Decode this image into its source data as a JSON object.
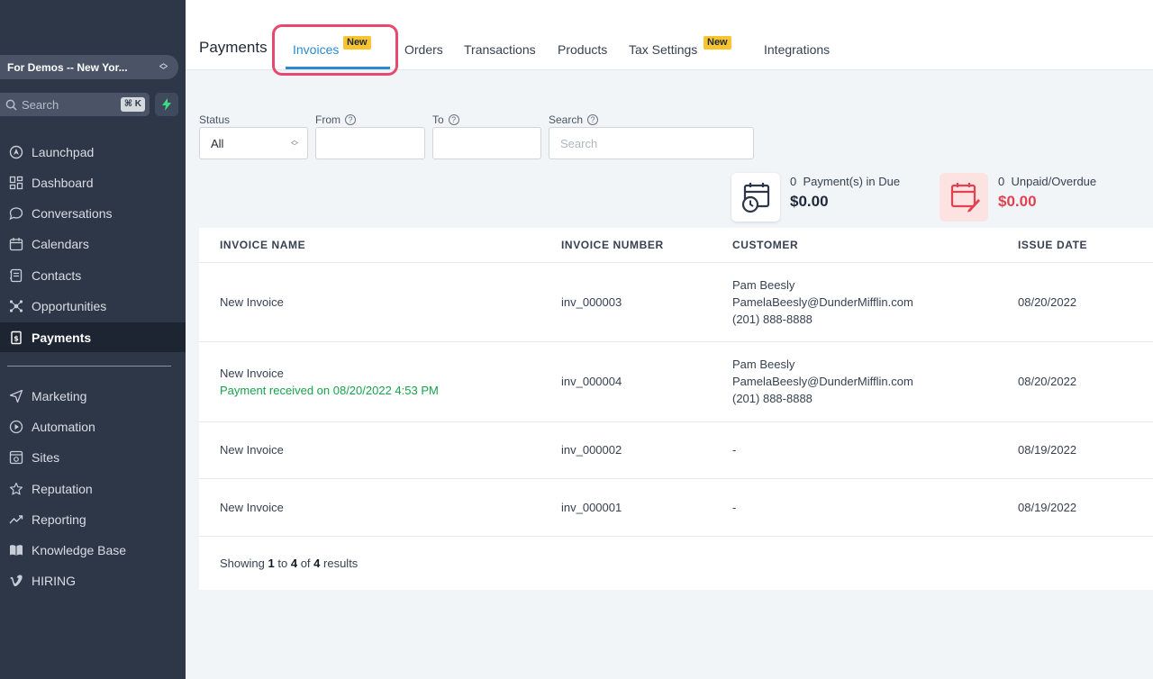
{
  "sidebar": {
    "location": "For Demos -- New Yor...",
    "search_placeholder": "Search",
    "search_shortcut": "⌘ K",
    "items": [
      {
        "label": "Launchpad",
        "icon": "launchpad-icon"
      },
      {
        "label": "Dashboard",
        "icon": "dashboard-icon"
      },
      {
        "label": "Conversations",
        "icon": "chat-icon"
      },
      {
        "label": "Calendars",
        "icon": "calendar-icon"
      },
      {
        "label": "Contacts",
        "icon": "contacts-icon"
      },
      {
        "label": "Opportunities",
        "icon": "opportunities-icon"
      },
      {
        "label": "Payments",
        "icon": "payments-icon",
        "active": true
      },
      {
        "label": "Marketing",
        "icon": "send-icon"
      },
      {
        "label": "Automation",
        "icon": "automation-icon"
      },
      {
        "label": "Sites",
        "icon": "sites-icon"
      },
      {
        "label": "Reputation",
        "icon": "star-icon"
      },
      {
        "label": "Reporting",
        "icon": "chart-line-icon"
      },
      {
        "label": "Knowledge Base",
        "icon": "book-icon"
      },
      {
        "label": "HIRING",
        "icon": "vimeo-icon"
      }
    ]
  },
  "header": {
    "title": "Payments",
    "tabs": [
      {
        "label": "Invoices",
        "badge": "New",
        "active": true
      },
      {
        "label": "Orders"
      },
      {
        "label": "Transactions"
      },
      {
        "label": "Products"
      },
      {
        "label": "Tax Settings",
        "badge": "New"
      },
      {
        "label": "Integrations"
      }
    ]
  },
  "filters": {
    "status_label": "Status",
    "status_value": "All",
    "from_label": "From",
    "to_label": "To",
    "search_label": "Search",
    "search_placeholder": "Search"
  },
  "stats": {
    "due_count": "0",
    "due_label": "Payment(s) in Due",
    "due_amount": "$0.00",
    "overdue_count": "0",
    "overdue_label": "Unpaid/Overdue",
    "overdue_amount": "$0.00"
  },
  "table": {
    "columns": [
      "INVOICE NAME",
      "INVOICE NUMBER",
      "CUSTOMER",
      "ISSUE DATE"
    ],
    "rows": [
      {
        "name": "New Invoice",
        "note": "",
        "number": "inv_000003",
        "customer_name": "Pam Beesly",
        "customer_email": "PamelaBeesly@DunderMifflin.com",
        "customer_phone": "(201) 888-8888",
        "date": "08/20/2022"
      },
      {
        "name": "New Invoice",
        "note": "Payment received on 08/20/2022 4:53 PM",
        "number": "inv_000004",
        "customer_name": "Pam Beesly",
        "customer_email": "PamelaBeesly@DunderMifflin.com",
        "customer_phone": "(201) 888-8888",
        "date": "08/20/2022"
      },
      {
        "name": "New Invoice",
        "note": "",
        "number": "inv_000002",
        "customer_dash": "-",
        "date": "08/19/2022"
      },
      {
        "name": "New Invoice",
        "note": "",
        "number": "inv_000001",
        "customer_dash": "-",
        "date": "08/19/2022"
      }
    ],
    "footer": {
      "prefix": "Showing",
      "from": "1",
      "to_word": "to",
      "to": "4",
      "of_word": "of",
      "total": "4",
      "suffix": "results"
    }
  },
  "colors": {
    "sidebar_bg": "#2e3747",
    "accent": "#2a8bd2",
    "badge": "#f8c531",
    "highlight": "#e8486f",
    "overdue": "#e0424f",
    "paid": "#16a34a"
  }
}
